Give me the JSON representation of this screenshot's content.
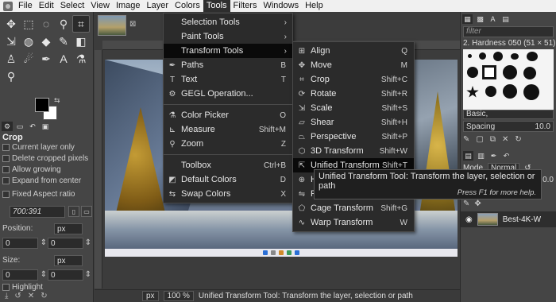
{
  "menubar": [
    "File",
    "Edit",
    "Select",
    "View",
    "Image",
    "Layer",
    "Colors",
    "Tools",
    "Filters",
    "Windows",
    "Help"
  ],
  "open_menu": "Tools",
  "tools_menu": [
    {
      "label": "Selection Tools",
      "submenu": true
    },
    {
      "label": "Paint Tools",
      "submenu": true
    },
    {
      "label": "Transform Tools",
      "submenu": true,
      "highlighted": true
    },
    {
      "label": "Paths",
      "shortcut": "B",
      "icon": "paths-icon"
    },
    {
      "label": "Text",
      "shortcut": "T",
      "icon": "text-icon"
    },
    {
      "label": "GEGL Operation...",
      "icon": "gegl-icon"
    },
    {
      "separator": true
    },
    {
      "label": "Color Picker",
      "shortcut": "O",
      "icon": "color-picker-icon"
    },
    {
      "label": "Measure",
      "shortcut": "Shift+M",
      "icon": "measure-icon"
    },
    {
      "label": "Zoom",
      "shortcut": "Z",
      "icon": "zoom-icon"
    },
    {
      "separator": true
    },
    {
      "label": "Toolbox",
      "shortcut": "Ctrl+B"
    },
    {
      "label": "Default Colors",
      "shortcut": "D",
      "icon": "default-colors-icon"
    },
    {
      "label": "Swap Colors",
      "shortcut": "X",
      "icon": "swap-colors-icon"
    }
  ],
  "transform_menu": [
    {
      "label": "Align",
      "shortcut": "Q",
      "icon": "align-icon"
    },
    {
      "label": "Move",
      "shortcut": "M",
      "icon": "move-icon"
    },
    {
      "label": "Crop",
      "shortcut": "Shift+C",
      "icon": "crop-icon"
    },
    {
      "label": "Rotate",
      "shortcut": "Shift+R",
      "icon": "rotate-icon"
    },
    {
      "label": "Scale",
      "shortcut": "Shift+S",
      "icon": "scale-icon"
    },
    {
      "label": "Shear",
      "shortcut": "Shift+H",
      "icon": "shear-icon"
    },
    {
      "label": "Perspective",
      "shortcut": "Shift+P",
      "icon": "perspective-icon"
    },
    {
      "label": "3D Transform",
      "shortcut": "Shift+W",
      "icon": "3d-transform-icon"
    },
    {
      "label": "Unified Transform",
      "shortcut": "Shift+T",
      "icon": "unified-transform-icon",
      "highlighted": true
    },
    {
      "label": "Ha",
      "shortcut": "",
      "icon": "handle-transform-icon"
    },
    {
      "label": "Fli",
      "shortcut": "",
      "icon": "flip-icon"
    },
    {
      "label": "Cage Transform",
      "shortcut": "Shift+G",
      "icon": "cage-transform-icon"
    },
    {
      "label": "Warp Transform",
      "shortcut": "W",
      "icon": "warp-transform-icon"
    }
  ],
  "tooltip": {
    "text": "Unified Transform Tool: Transform the layer, selection or path",
    "hint": "Press F1 for more help."
  },
  "tool_options": {
    "title": "Crop",
    "current_layer_only": "Current layer only",
    "delete_cropped": "Delete cropped pixels",
    "allow_growing": "Allow growing",
    "expand_from_center": "Expand from center",
    "fixed_aspect_ratio": "Fixed  Aspect ratio",
    "ratio_value": "700:391",
    "position_label": "Position:",
    "position_unit": "px",
    "position_x": "0",
    "position_y": "0",
    "size_label": "Size:",
    "size_unit": "px",
    "size_x": "0",
    "size_y": "0",
    "highlight": "Highlight"
  },
  "right_dock": {
    "filter_placeholder": "filter",
    "brush_name": "2. Hardness 050 (51 × 51)",
    "brush_set": "Basic,",
    "spacing_label": "Spacing",
    "spacing_value": "10.0",
    "mode_label": "Mode",
    "mode_value": "Normal",
    "opacity_value": "0.0",
    "layer_name": "Best-4K-W"
  },
  "status_bar": {
    "unit": "px",
    "zoom": "100 %",
    "message": "Unified Transform Tool: Transform the layer, selection or path"
  }
}
